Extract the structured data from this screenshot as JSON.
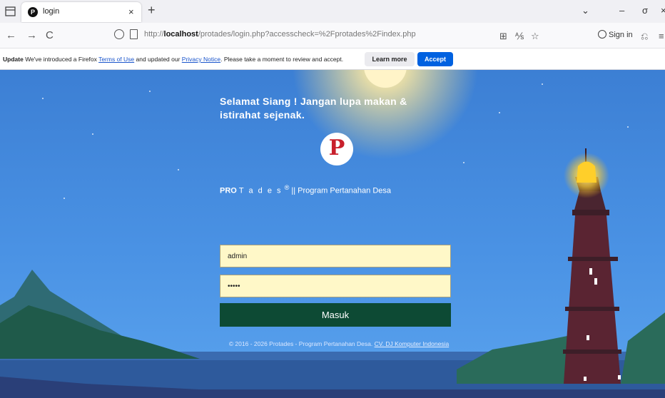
{
  "browser": {
    "tab": {
      "favicon": "P",
      "title": "login",
      "close": "×"
    },
    "new_tab": "+",
    "window_controls": {
      "list": "⌄",
      "minimize": "–",
      "restore": "σ",
      "close": "×"
    },
    "url": {
      "prefix": "http://",
      "host": "localhost",
      "path": "/protades/login.php?accesscheck=%2Fprotades%2Findex.php"
    },
    "nav": {
      "back": "←",
      "forward": "→",
      "reload": "C"
    },
    "toolbar": {
      "reader": "⊞",
      "translate": "⅍",
      "bookmark": "☆",
      "signin": "Sign in",
      "extensions": "⎌",
      "menu": "≡"
    }
  },
  "notification": {
    "label": "Update",
    "text_1": "We've introduced a Firefox ",
    "link_terms": "Terms of Use",
    "text_2": " and updated our ",
    "link_privacy": "Privacy Notice",
    "text_3": ". Please take a moment to review and accept.",
    "learn_more": "Learn more",
    "accept": "Accept"
  },
  "login": {
    "greeting": "Selamat Siang ! Jangan lupa makan & istirahat sejenak.",
    "logo_letter": "P",
    "brand_pro": "PRO",
    "brand_tades": "T a d e s",
    "brand_reg": "®",
    "brand_rest": " || Program Pertanahan Desa",
    "username_value": "admin",
    "password_value": "•••••",
    "submit_label": "Masuk",
    "footer_text": "© 2016 - 2026 Protades - Program Pertanahan Desa. ",
    "footer_link": "CV. DJ Komputer Indonesia"
  },
  "colors": {
    "sky": "#4a92e4",
    "button": "#0d4a34",
    "input_bg": "#fff8c8",
    "accept": "#0061e0",
    "logo": "#c8202c"
  }
}
